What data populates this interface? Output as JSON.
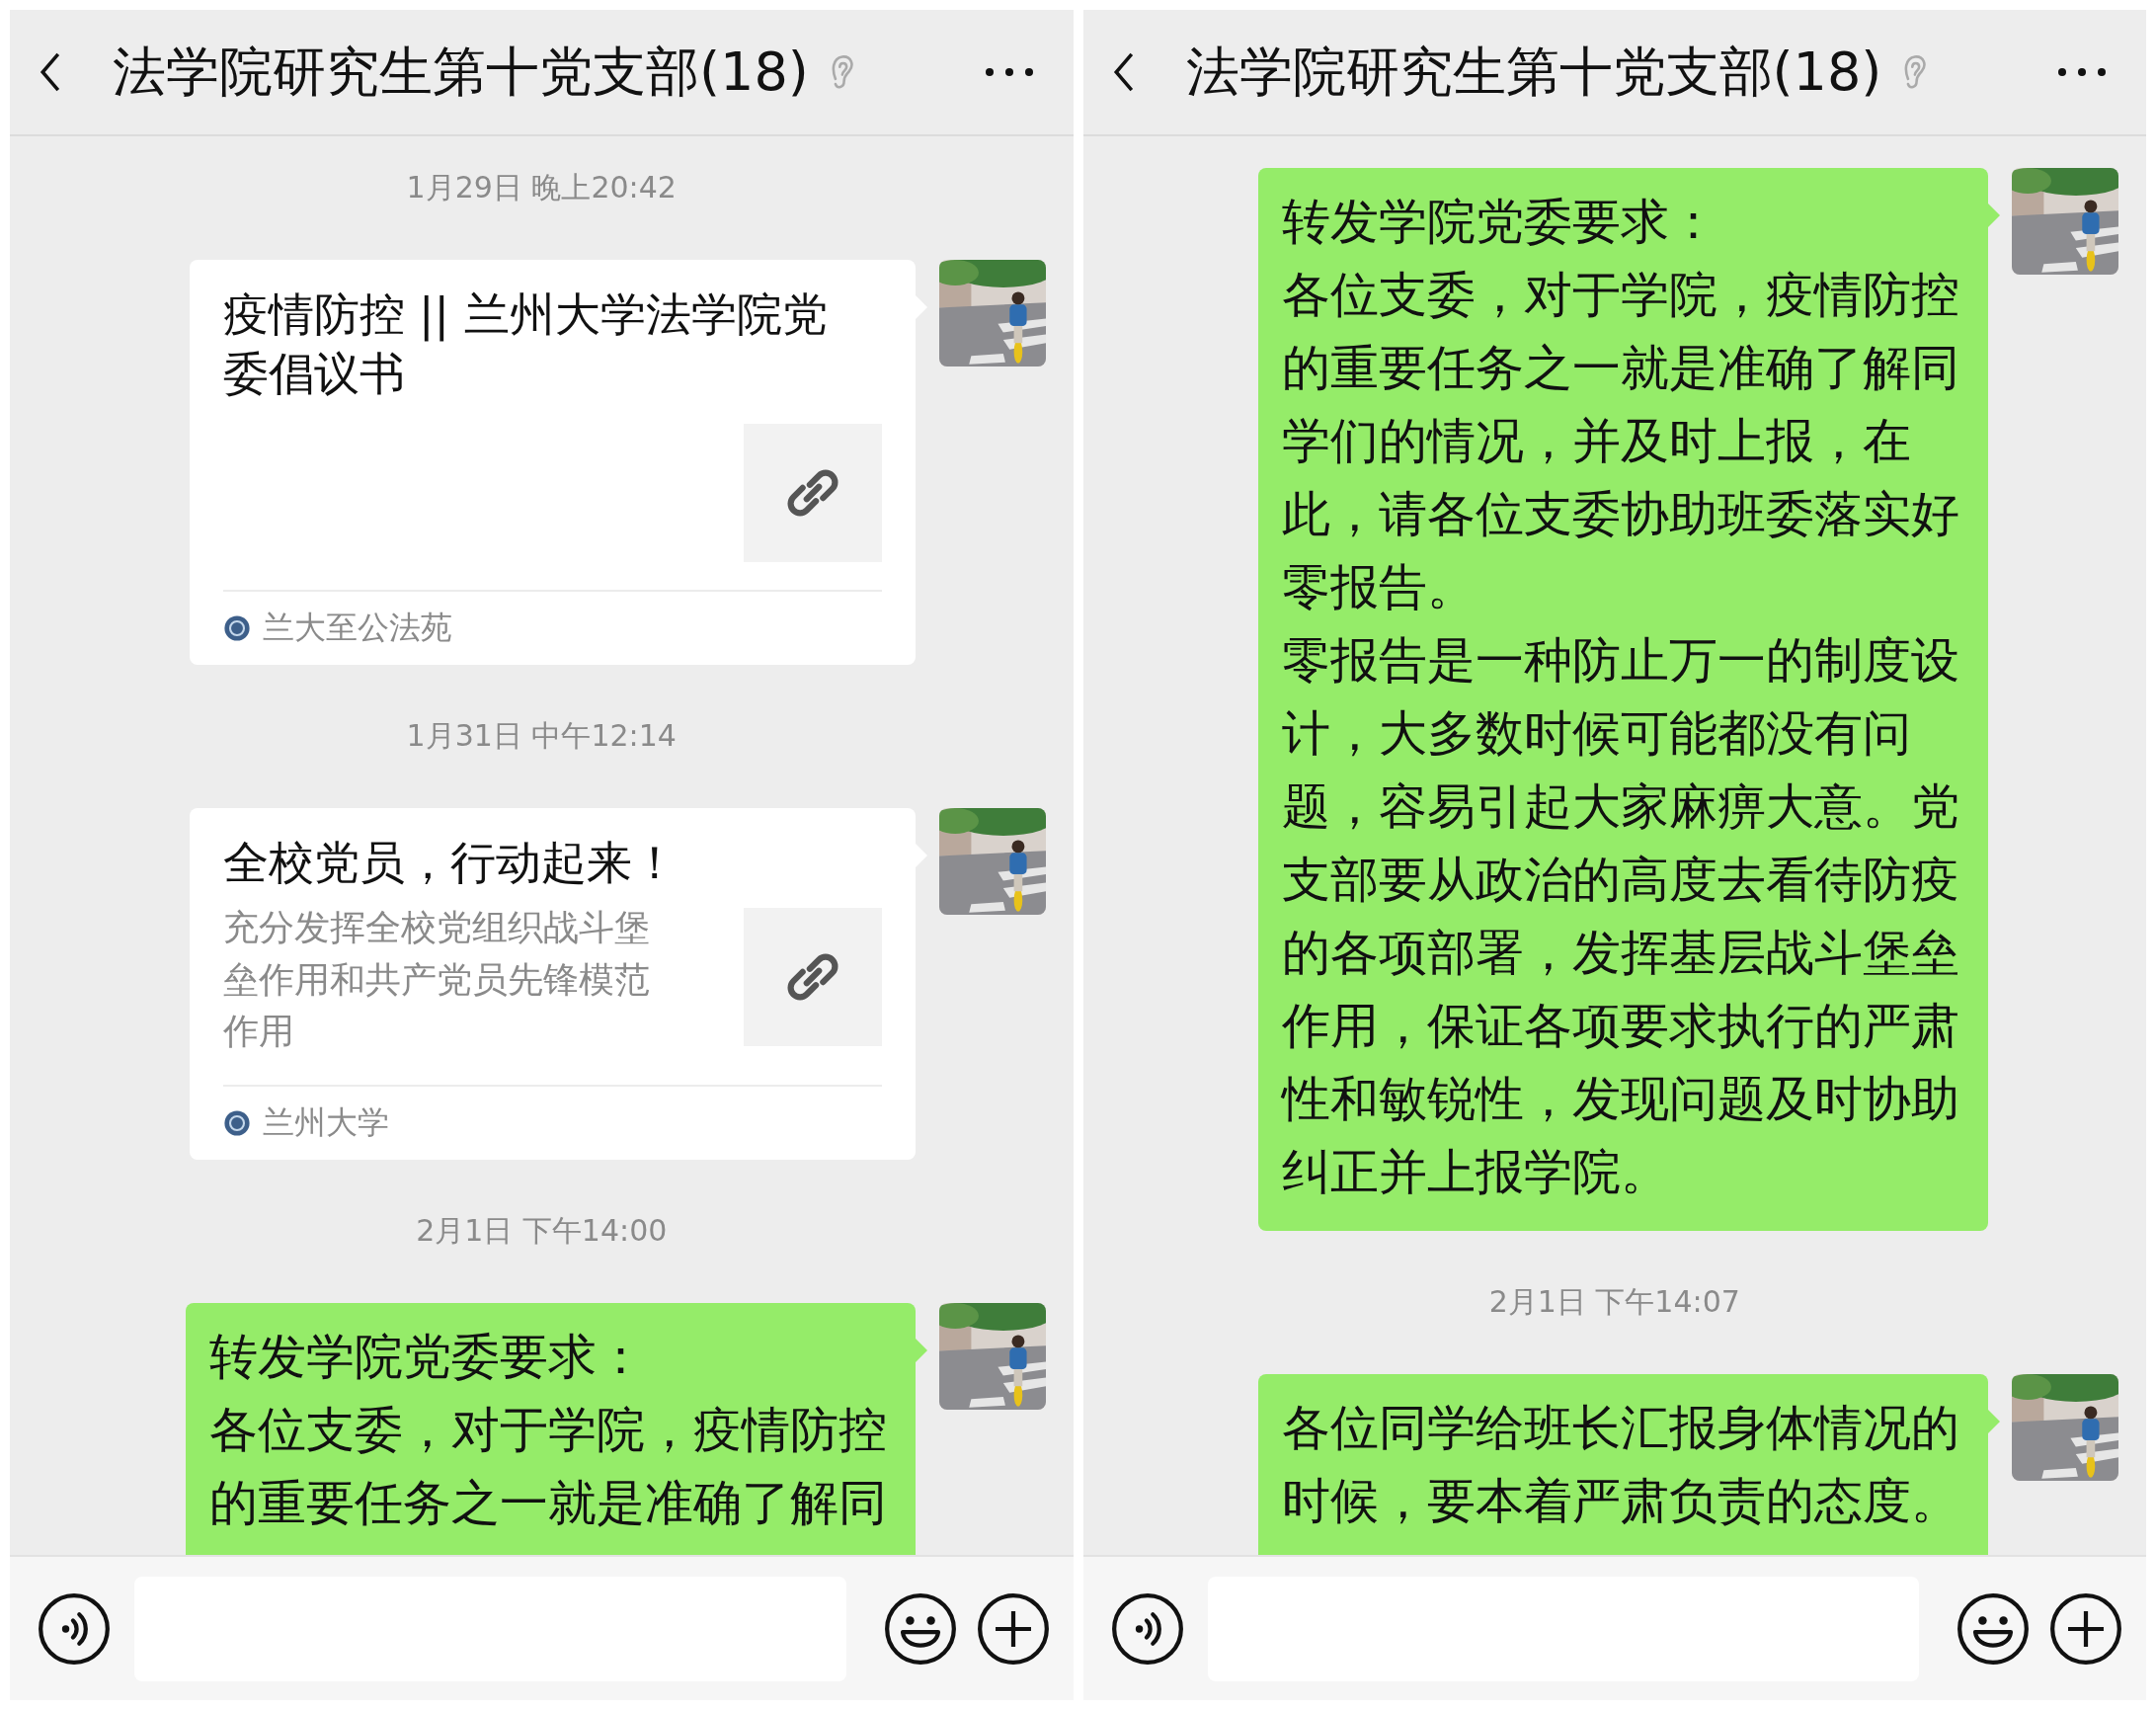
{
  "panels": [
    {
      "header": {
        "title": "法学院研究生第十党支部(18)"
      },
      "messages": [
        {
          "kind": "time",
          "text": "1月29日 晚上20:42"
        },
        {
          "kind": "link",
          "title": "疫情防控 || 兰州大学法学院党委倡议书",
          "source": "兰大至公法苑"
        },
        {
          "kind": "time",
          "text": "1月31日 中午12:14"
        },
        {
          "kind": "link",
          "title": "全校党员，行动起来！",
          "description": "充分发挥全校党组织战斗堡垒作用和共产党员先锋模范作用",
          "source": "兰州大学"
        },
        {
          "kind": "time",
          "text": "2月1日 下午14:00"
        },
        {
          "kind": "text",
          "paragraphs": [
            "转发学院党委要求：",
            "各位支委，对于学院，疫情防控的重要任务之一就是准确了解同"
          ]
        }
      ]
    },
    {
      "header": {
        "title": "法学院研究生第十党支部(18)"
      },
      "messages": [
        {
          "kind": "text",
          "paragraphs": [
            "转发学院党委要求：",
            "各位支委，对于学院，疫情防控的重要任务之一就是准确了解同学们的情况，并及时上报，在此，请各位支委协助班委落实好零报告。",
            "零报告是一种防止万一的制度设计，大多数时候可能都没有问题，容易引起大家麻痹大意。党支部要从政治的高度去看待防疫的各项部署，发挥基层战斗堡垒作用，保证各项要求执行的严肃性和敏锐性，发现问题及时协助纠正并上报学院。"
          ]
        },
        {
          "kind": "time",
          "text": "2月1日 下午14:07"
        },
        {
          "kind": "text",
          "paragraphs": [
            "各位同学给班长汇报身体情况的时候，要本着严肃负责的态度。"
          ]
        }
      ]
    }
  ]
}
